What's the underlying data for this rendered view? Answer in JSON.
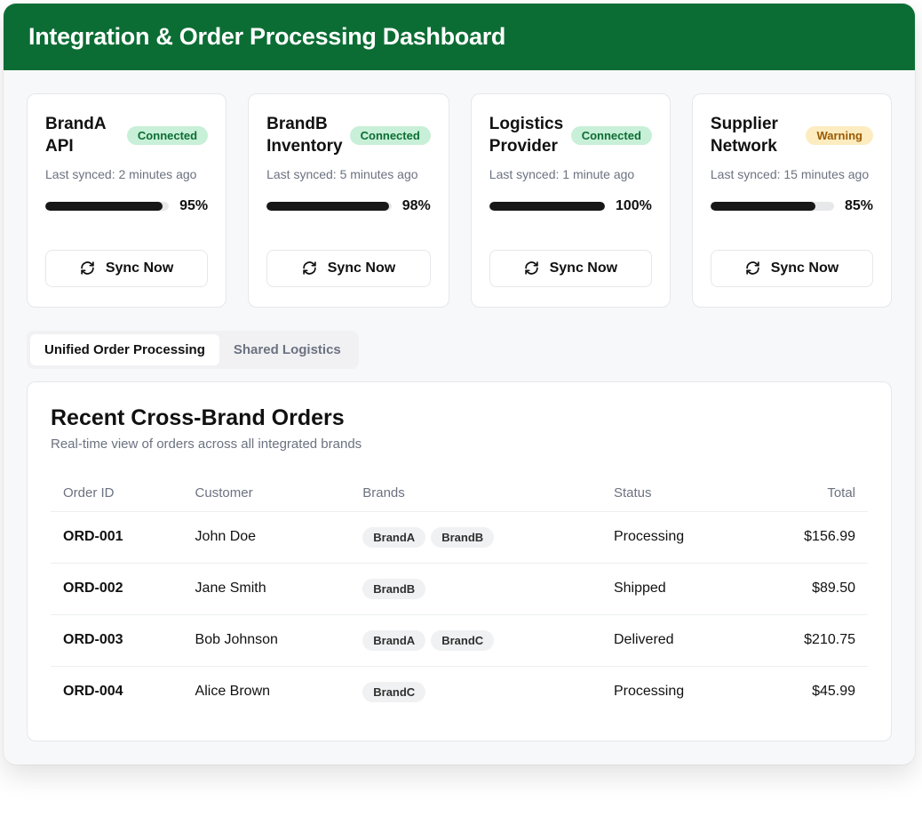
{
  "header": {
    "title": "Integration & Order Processing Dashboard"
  },
  "cards": [
    {
      "title": "BrandA API",
      "status": "Connected",
      "statusClass": "connected",
      "lastSync": "Last synced: 2 minutes ago",
      "progress": 95,
      "progressLabel": "95%",
      "button": "Sync Now"
    },
    {
      "title": "BrandB Inventory",
      "status": "Connected",
      "statusClass": "connected",
      "lastSync": "Last synced: 5 minutes ago",
      "progress": 98,
      "progressLabel": "98%",
      "button": "Sync Now"
    },
    {
      "title": "Logistics Provider",
      "status": "Connected",
      "statusClass": "connected",
      "lastSync": "Last synced: 1 minute ago",
      "progress": 100,
      "progressLabel": "100%",
      "button": "Sync Now"
    },
    {
      "title": "Supplier Network",
      "status": "Warning",
      "statusClass": "warning",
      "lastSync": "Last synced: 15 minutes ago",
      "progress": 85,
      "progressLabel": "85%",
      "button": "Sync Now"
    }
  ],
  "tabs": [
    {
      "label": "Unified Order Processing",
      "active": true
    },
    {
      "label": "Shared Logistics",
      "active": false
    }
  ],
  "ordersPanel": {
    "title": "Recent Cross-Brand Orders",
    "subtitle": "Real-time view of orders across all integrated brands",
    "columns": [
      "Order ID",
      "Customer",
      "Brands",
      "Status",
      "Total"
    ],
    "rows": [
      {
        "id": "ORD-001",
        "customer": "John Doe",
        "brands": [
          "BrandA",
          "BrandB"
        ],
        "status": "Processing",
        "total": "$156.99"
      },
      {
        "id": "ORD-002",
        "customer": "Jane Smith",
        "brands": [
          "BrandB"
        ],
        "status": "Shipped",
        "total": "$89.50"
      },
      {
        "id": "ORD-003",
        "customer": "Bob Johnson",
        "brands": [
          "BrandA",
          "BrandC"
        ],
        "status": "Delivered",
        "total": "$210.75"
      },
      {
        "id": "ORD-004",
        "customer": "Alice Brown",
        "brands": [
          "BrandC"
        ],
        "status": "Processing",
        "total": "$45.99"
      }
    ]
  }
}
